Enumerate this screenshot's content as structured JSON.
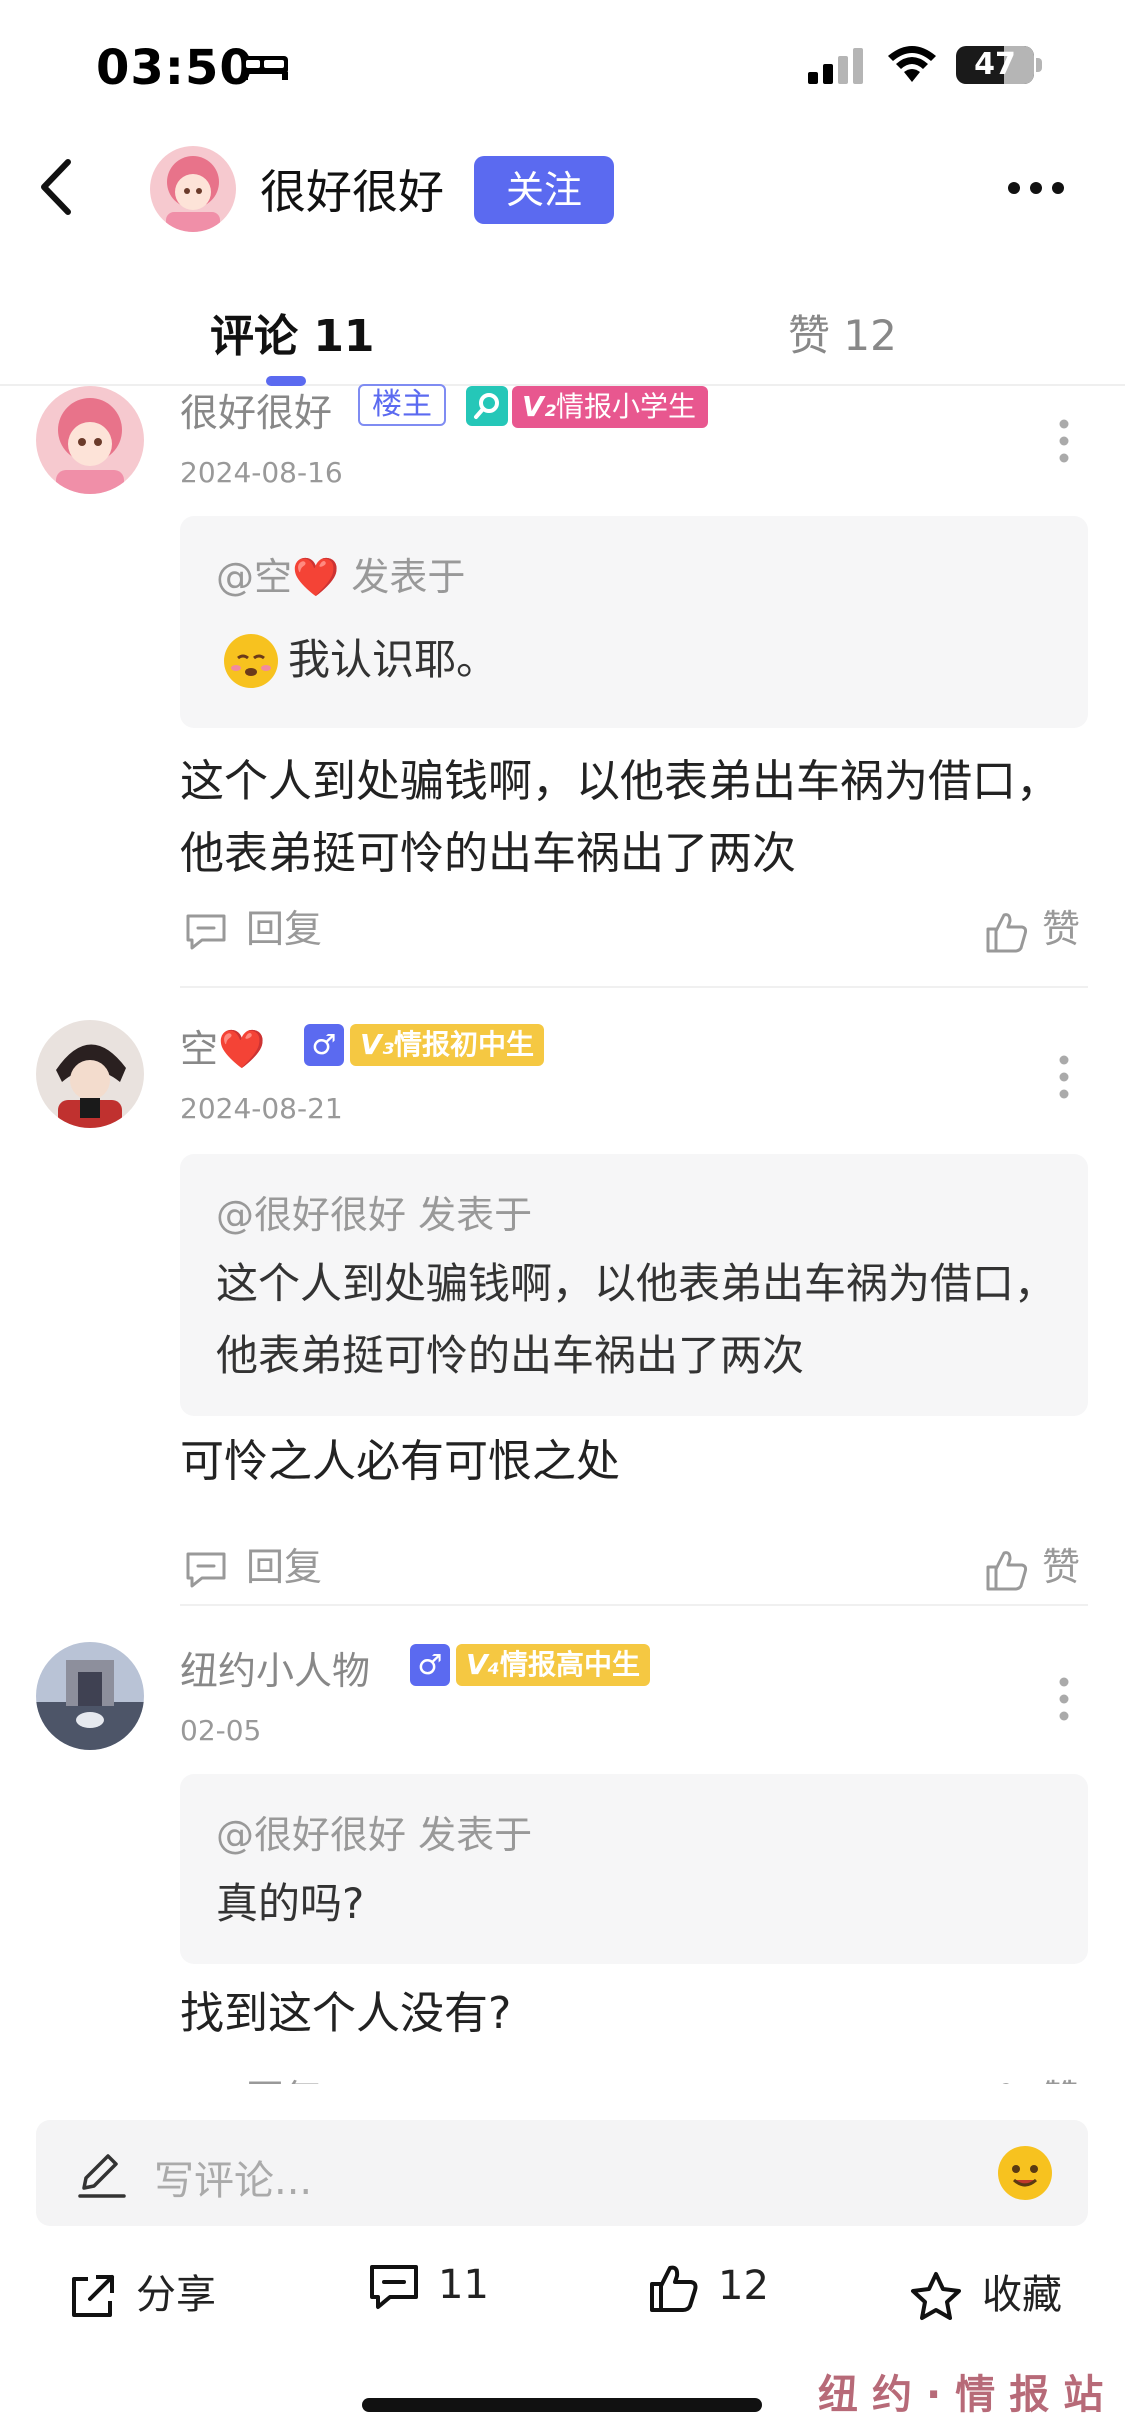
{
  "status": {
    "time": "03:50",
    "battery": "47"
  },
  "header": {
    "user_name": "很好很好",
    "follow_label": "关注"
  },
  "tabs": {
    "comments_label": "评论 11",
    "likes_label": "赞 12"
  },
  "comments": [
    {
      "name": "很好很好",
      "badges": [
        "楼主",
        "情报小学生"
      ],
      "date": "2024-08-16",
      "quote_head": "@空❤️ 发表于",
      "quote_text": "我认识耶。",
      "body": "这个人到处骗钱啊，以他表弟出车祸为借口，他表弟挺可怜的出车祸出了两次",
      "reply_label": "回复",
      "like_label": "赞"
    },
    {
      "name": "空❤️",
      "badges": [
        "♂",
        "情报初中生"
      ],
      "date": "2024-08-21",
      "quote_head": "@很好很好 发表于",
      "quote_text": "这个人到处骗钱啊，以他表弟出车祸为借口，他表弟挺可怜的出车祸出了两次",
      "body": "可怜之人必有可恨之处",
      "reply_label": "回复",
      "like_label": "赞"
    },
    {
      "name": "纽约小人物",
      "badges": [
        "♂",
        "情报高中生"
      ],
      "date": "02-05",
      "quote_head": "@很好很好 发表于",
      "quote_text": "真的吗?",
      "body": "找到这个人没有?",
      "reply_label": "回复",
      "like_label": "赞"
    }
  ],
  "input": {
    "placeholder": "写评论..."
  },
  "actions": {
    "share": "分享",
    "comments": "11",
    "likes": "12",
    "favorite": "收藏"
  },
  "watermark": "纽约·情报站",
  "colors": {
    "accent": "#5b6af0",
    "vip_pink": "#e8578f",
    "vip_gold": "#f5c842",
    "male_blue": "#5b6af0"
  }
}
